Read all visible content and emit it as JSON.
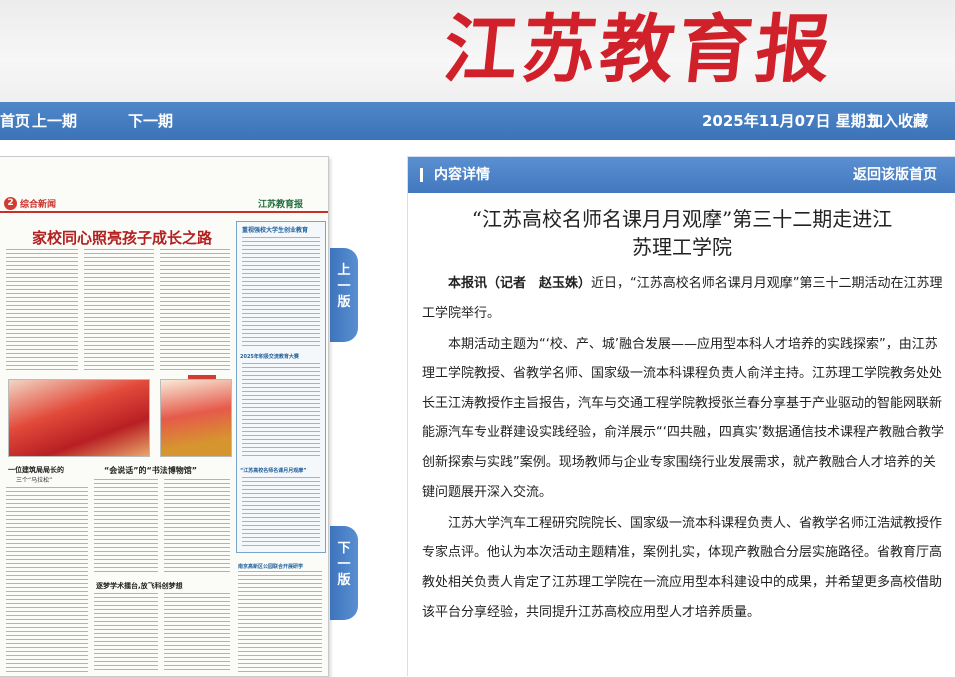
{
  "masthead": {
    "title": "江苏教育报"
  },
  "nav": {
    "home": "首页",
    "prev_issue": "上一期",
    "next_issue": "下一期",
    "date": "2025年11月07日 星期五",
    "bookmark": "加入收藏"
  },
  "pager": {
    "prev_page": "上一版",
    "next_page": "下一版"
  },
  "newspaper_page": {
    "page_no": "2",
    "section": "综合新闻",
    "brand": "江苏教育报",
    "headline": "家校同心照亮孩子成长之路",
    "caption_1": "一位建筑局局长的",
    "caption_2": "三个“马拉松”",
    "caption_3": "“会说话”的“书法博物馆”",
    "caption_4": "逐梦学术擂台,放飞科创梦想",
    "box_title": "重视强校大学生创业教育",
    "box_item_1": "2025年积极交流教育大赛",
    "box_item_2": "“江苏高校名师名课月月观摩”",
    "box_item_3": "南京高新区公园联合开展研学"
  },
  "panel": {
    "header": "内容详情",
    "back_link": "返回该版首页"
  },
  "article": {
    "title_line1": "“江苏高校名师名课月月观摩”第三十二期走进江",
    "title_line2": "苏理工学院",
    "lead": "本报讯（记者　赵玉姝）",
    "p1_rest": "近日，“江苏高校名师名课月月观摩”第三十二期活动在江苏理工学院举行。",
    "p2": "本期活动主题为“‘校、产、城’融合发展——应用型本科人才培养的实践探索”，由江苏理工学院教授、省教学名师、国家级一流本科课程负责人俞洋主持。江苏理工学院教务处处长王江涛教授作主旨报告，汽车与交通工程学院教授张兰春分享基于产业驱动的智能网联新能源汽车专业群建设实践经验，俞洋展示“‘四共融，四真实’数据通信技术课程产教融合教学创新探索与实践”案例。现场教师与企业专家围绕行业发展需求，就产教融合人才培养的关键问题展开深入交流。",
    "p3": "江苏大学汽车工程研究院院长、国家级一流本科课程负责人、省教学名师江浩斌教授作专家点评。他认为本次活动主题精准，案例扎实，体现产教融合分层实施路径。省教育厅高教处相关负责人肯定了江苏理工学院在一流应用型本科建设中的成果，并希望更多高校借助该平台分享经验，共同提升江苏高校应用型人才培养质量。"
  }
}
